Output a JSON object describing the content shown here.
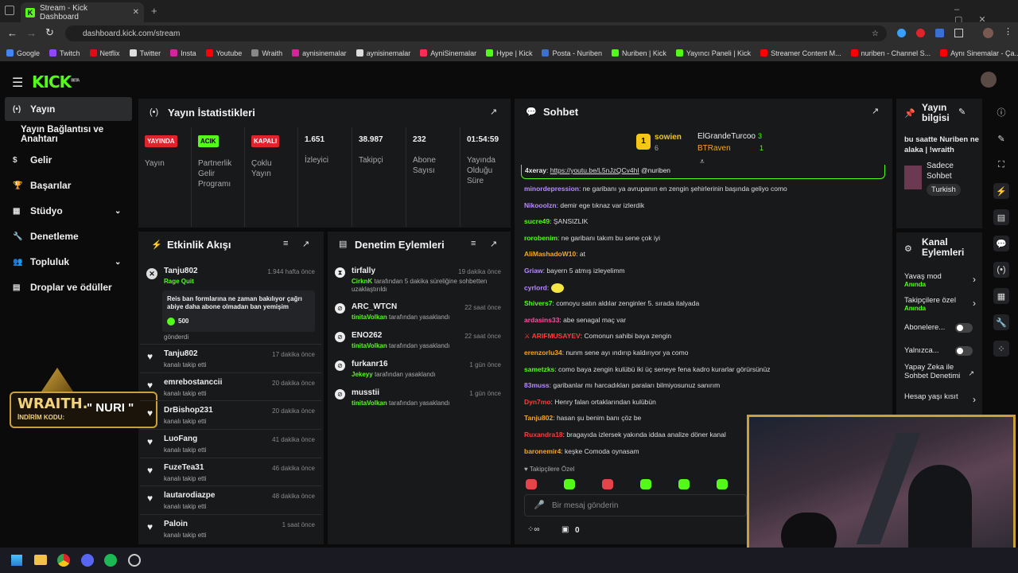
{
  "browser": {
    "tab_title": "Stream - Kick Dashboard",
    "url": "dashboard.kick.com/stream",
    "bookmarks": [
      "Google",
      "Twitch",
      "Netflix",
      "Twitter",
      "Insta",
      "Youtube",
      "Wraith",
      "aynisinemalar",
      "aynisinemalar",
      "AyniSinemalar",
      "Hype | Kick",
      "Posta - Nuriben",
      "Nuriben | Kick",
      "Yayıncı Paneli | Kick",
      "Streamer Content M...",
      "nuriben - Channel S...",
      "Aynı Sinemalar - Ça..."
    ]
  },
  "logo": "KICK",
  "logo_beta": "BETA",
  "nav": {
    "items": [
      "Yayın",
      "Yayın Bağlantısı ve Anahtarı",
      "Gelir",
      "Başarılar",
      "Stüdyo",
      "Denetleme",
      "Topluluk",
      "Droplar ve ödüller"
    ]
  },
  "stats": {
    "title": "Yayın İstatistikleri",
    "cells": [
      {
        "badge": "YAYINDA",
        "badge_color": "#e0242b",
        "label": "Yayın"
      },
      {
        "badge": "ACIK",
        "badge_color": "#53fc18",
        "label": "Partnerlik Gelir Programı"
      },
      {
        "badge": "KAPALI",
        "badge_color": "#e0242b",
        "label": "Çoklu Yayın"
      },
      {
        "value": "1.651",
        "label": "İzleyici"
      },
      {
        "value": "38.987",
        "label": "Takipçi"
      },
      {
        "value": "232",
        "label": "Abone Sayısı"
      },
      {
        "value": "01:54:59",
        "label": "Yayında Olduğu Süre"
      }
    ]
  },
  "activity": {
    "title": "Etkinlik Akışı",
    "first": {
      "name": "Tanju802",
      "time": "1.944 hafta önce",
      "sub": "Rage Quit",
      "message": "Reis ban formlarına ne zaman bakılıyor çağrı abiye daha abone olmadan ban yemişim",
      "amount": "500",
      "footer": "gönderdi"
    },
    "items": [
      {
        "name": "Tanju802",
        "time": "17 dakika önce",
        "sub": "kanalı takip etti"
      },
      {
        "name": "emrebostanccii",
        "time": "20 dakika önce",
        "sub": "kanalı takip etti"
      },
      {
        "name": "DrBishop231",
        "time": "20 dakika önce",
        "sub": "kanalı takip etti"
      },
      {
        "name": "LuoFang",
        "time": "41 dakika önce",
        "sub": "kanalı takip etti"
      },
      {
        "name": "FuzeTea31",
        "time": "46 dakika önce",
        "sub": "kanalı takip etti"
      },
      {
        "name": "lautarodiazpe",
        "time": "48 dakika önce",
        "sub": "kanalı takip etti"
      },
      {
        "name": "Paloin",
        "time": "1 saat önce",
        "sub": "kanalı takip etti"
      }
    ]
  },
  "moderation": {
    "title": "Denetim Eylemleri",
    "items": [
      {
        "name": "tirfally",
        "time": "19 dakika önce",
        "mod": "CirknK",
        "sub": "tarafından 5 dakika süreliğine sohbetten uzaklaştırıldı"
      },
      {
        "name": "ARC_WTCN",
        "time": "22 saat önce",
        "mod": "tinitaVolkan",
        "sub": "tarafından yasaklandı"
      },
      {
        "name": "ENO262",
        "time": "22 saat önce",
        "mod": "tinitaVolkan",
        "sub": "tarafından yasaklandı"
      },
      {
        "name": "furkanr16",
        "time": "1 gün önce",
        "mod": "Jekeyy",
        "sub": "tarafından yasaklandı"
      },
      {
        "name": "musstii",
        "time": "1 gün önce",
        "mod": "tinitaVolkan",
        "sub": "tarafından yasaklandı"
      }
    ]
  },
  "chat": {
    "title": "Sohbet",
    "leader": {
      "rank": "1",
      "name": "sowien",
      "count": "6",
      "second": "ElGrandeTurcoo",
      "second_count": "3",
      "third": "BTRaven",
      "third_count": "1"
    },
    "pinned": {
      "user": "4xeray",
      "link": "https://youtu.be/L5nJzQCv4hI",
      "text": "@nuriben"
    },
    "messages": [
      {
        "user": "minordepression",
        "color": "#b78cff",
        "text": "ne garibanı ya avrupanın en zengin şehirlerinin başında geliyo como"
      },
      {
        "user": "Nikooolzn",
        "color": "#b78cff",
        "text": "demir ege tıknaz var izlerdik"
      },
      {
        "user": "sucre49",
        "color": "#53fc18",
        "text": "ŞANSIZLIK"
      },
      {
        "user": "rorobenim",
        "color": "#53fc18",
        "text": "ne garibanı takım bu sene çok iyi"
      },
      {
        "user": "AliMashadoW10",
        "color": "#f5a623",
        "text": "at"
      },
      {
        "user": "Griaw",
        "color": "#b78cff",
        "text": "bayern 5 atmış izleyelimm"
      },
      {
        "user": "cyrlord",
        "color": "#b78cff",
        "text": ""
      },
      {
        "user": "Shivers7",
        "color": "#53fc18",
        "text": "comoyu satın aldılar zenginler 5. sırada italyada"
      },
      {
        "user": "ardasins33",
        "color": "#ff4fa0",
        "text": "abe senagal maç var"
      },
      {
        "user": "ARIFMUSAYEV",
        "color": "#ff3b3b",
        "text": "Comonun sahibi baya zengin"
      },
      {
        "user": "erenzorlu34",
        "color": "#f5a623",
        "text": "nunm sene ayı ındırıp kaldırıyor ya como"
      },
      {
        "user": "sametzks",
        "color": "#53fc18",
        "text": "como baya zengin kulübü iki üç seneye fena kadro kurarlar görürsünüz"
      },
      {
        "user": "83muss",
        "color": "#b78cff",
        "text": "garibanlar mı harcadıkları paraları bilmiyosunuz sanırım"
      },
      {
        "user": "Dyn7mo",
        "color": "#ff3b3b",
        "text": "Henry falan ortaklarından kulübün"
      },
      {
        "user": "Tanju802",
        "color": "#f5a623",
        "text": "hasan şu benim banı çöz be"
      },
      {
        "user": "Ruxandra18",
        "color": "#ff3b3b",
        "text": "bragayıda izlersek yakında iddaa analize döner kanal"
      },
      {
        "user": "baronemir4",
        "color": "#f5a623",
        "text": "keşke Comoda oynasam"
      }
    ],
    "followers_only": "Takipçilere Özel",
    "placeholder": "Bir mesaj gönderin",
    "count_label": "0"
  },
  "info": {
    "title": "Yayın bilgisi",
    "stream_title": "bu saatte Nuriben ne alaka | !wraith",
    "category": "Sadece Sohbet",
    "tag": "Turkish"
  },
  "channel": {
    "title": "Kanal Eylemleri",
    "items": [
      {
        "label": "Yavaş mod",
        "sub": "Anında",
        "kind": "arrow"
      },
      {
        "label": "Takipçilere özel",
        "sub": "Anında",
        "kind": "arrow"
      },
      {
        "label": "Abonelere...",
        "kind": "toggle"
      },
      {
        "label": "Yalnızca...",
        "kind": "toggle"
      },
      {
        "label": "Yapay Zeka ile Sohbet Denetimi",
        "kind": "ext"
      },
      {
        "label": "Hesap yaşı kısıt",
        "kind": "arrow"
      }
    ]
  },
  "wraith": {
    "brand": "WRAITH.",
    "code_label": "İNDİRİM KODU:",
    "code": "\" NURI \""
  },
  "colors": {
    "accent": "#53fc18",
    "panel": "#18191b",
    "bg": "#0b0b0c",
    "live": "#e0242b"
  }
}
